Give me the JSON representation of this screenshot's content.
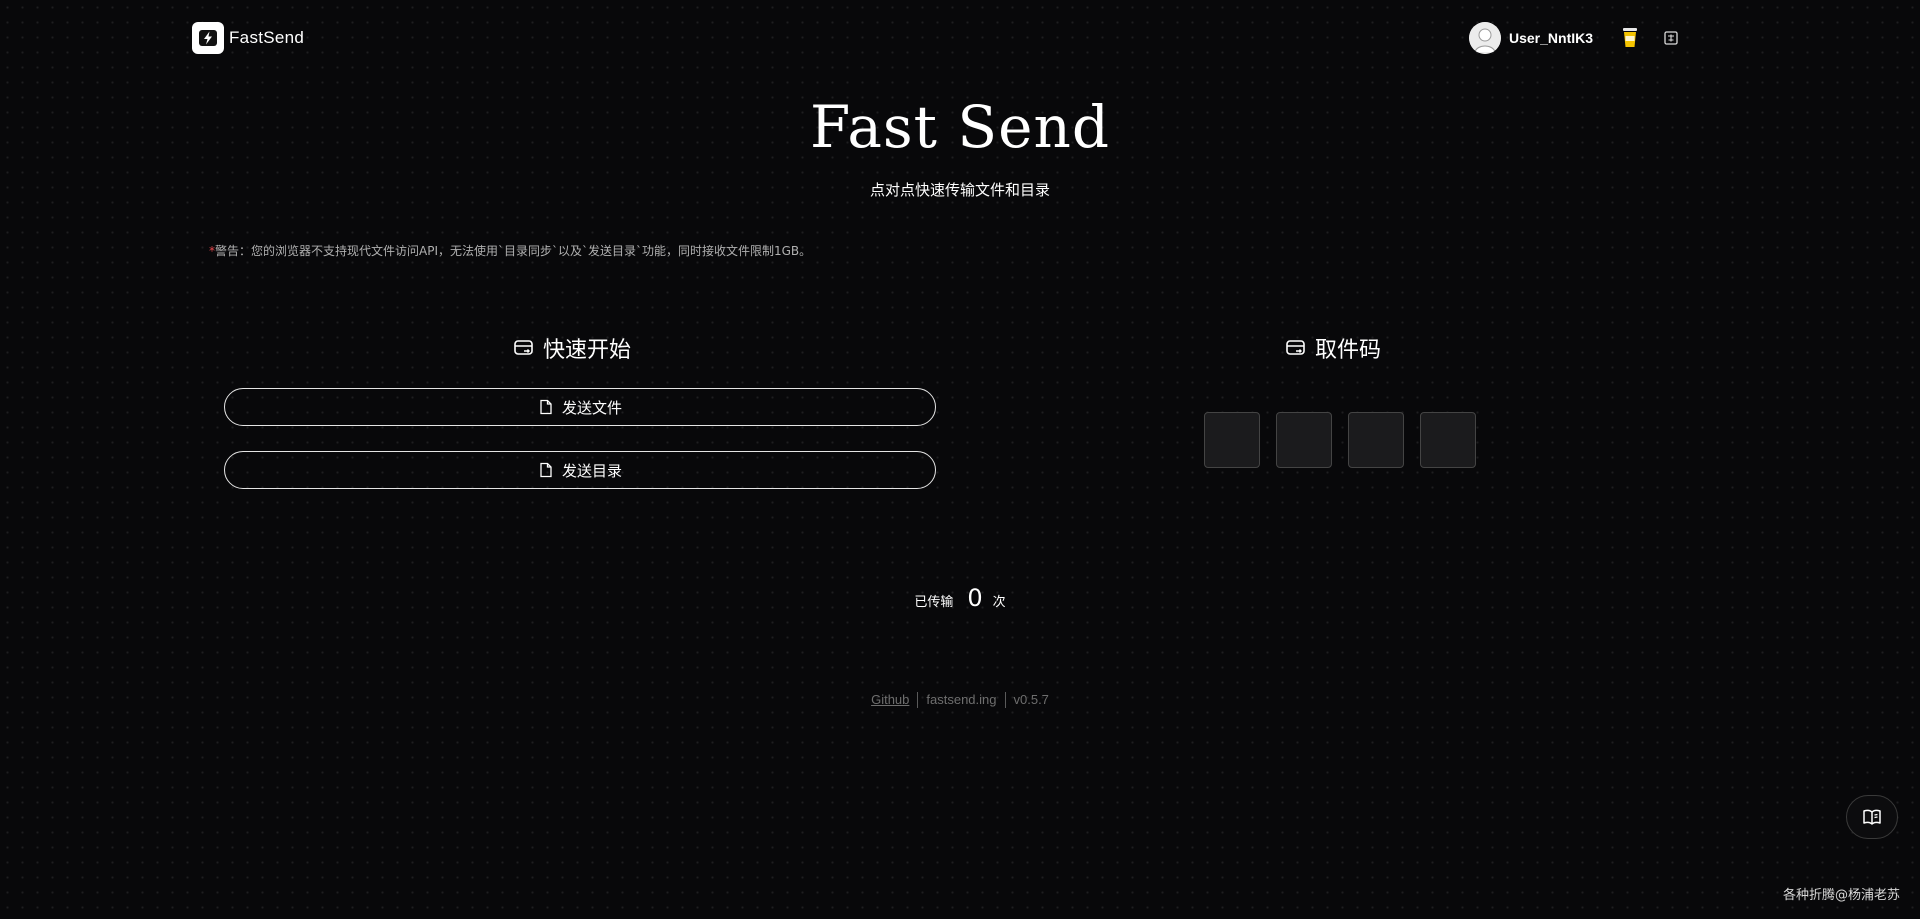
{
  "header": {
    "logo_text": "FastSend",
    "username": "User_NntIK3",
    "logo_icon": "lightning-bolt-icon",
    "coffee_icon": "coffee-cup-icon",
    "language_icon": "language-toggle-icon"
  },
  "hero": {
    "title": "Fast Send",
    "subtitle": "点对点快速传输文件和目录"
  },
  "warning": {
    "star": "*",
    "text": "警告：您的浏览器不支持现代文件访问API，无法使用`目录同步`以及`发送目录`功能，同时接收文件限制1GB。"
  },
  "quick_start": {
    "title": "快速开始",
    "send_file_label": "发送文件",
    "send_folder_label": "发送目录"
  },
  "pickup": {
    "title": "取件码",
    "codes": [
      "",
      "",
      "",
      ""
    ]
  },
  "stats": {
    "prefix": "已传输",
    "count": "0",
    "suffix": "次"
  },
  "footer": {
    "github": "Github",
    "domain": "fastsend.ing",
    "version": "v0.5.7"
  },
  "credit": "各种折腾@杨浦老苏",
  "colors": {
    "background": "#08080a",
    "text": "#ffffff",
    "warning_star": "#e5484d",
    "muted": "#6e6e6e"
  }
}
